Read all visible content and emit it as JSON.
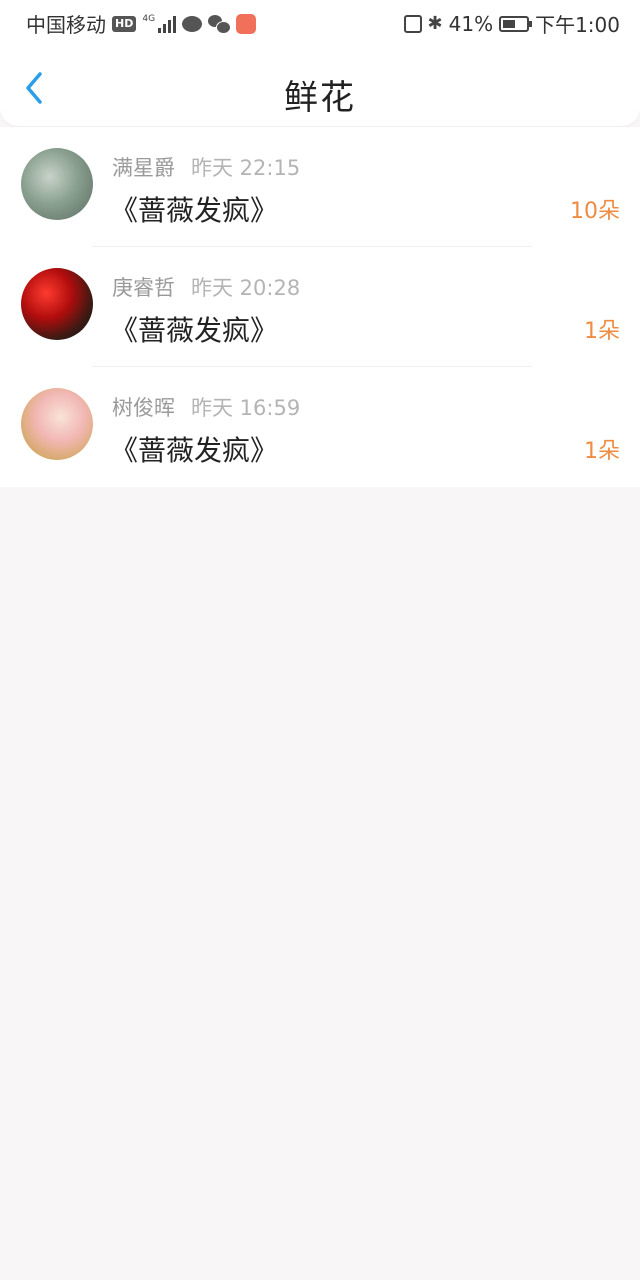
{
  "status_bar": {
    "carrier": "中国移动",
    "hd": "HD",
    "network": "4G",
    "battery_percent": "41%",
    "time": "下午1:00",
    "battery_level": 0.41
  },
  "nav": {
    "title": "鲜花"
  },
  "list": [
    {
      "name": "满星爵",
      "time": "昨天 22:15",
      "book": "《蔷薇发疯》",
      "count": "10朵"
    },
    {
      "name": "庚睿哲",
      "time": "昨天 20:28",
      "book": "《蔷薇发疯》",
      "count": "1朵"
    },
    {
      "name": "树俊晖",
      "time": "昨天 16:59",
      "book": "《蔷薇发疯》",
      "count": "1朵"
    }
  ],
  "colors": {
    "accent": "#2a9ee8",
    "count": "#ef8c42",
    "background": "#f8f6f7"
  }
}
